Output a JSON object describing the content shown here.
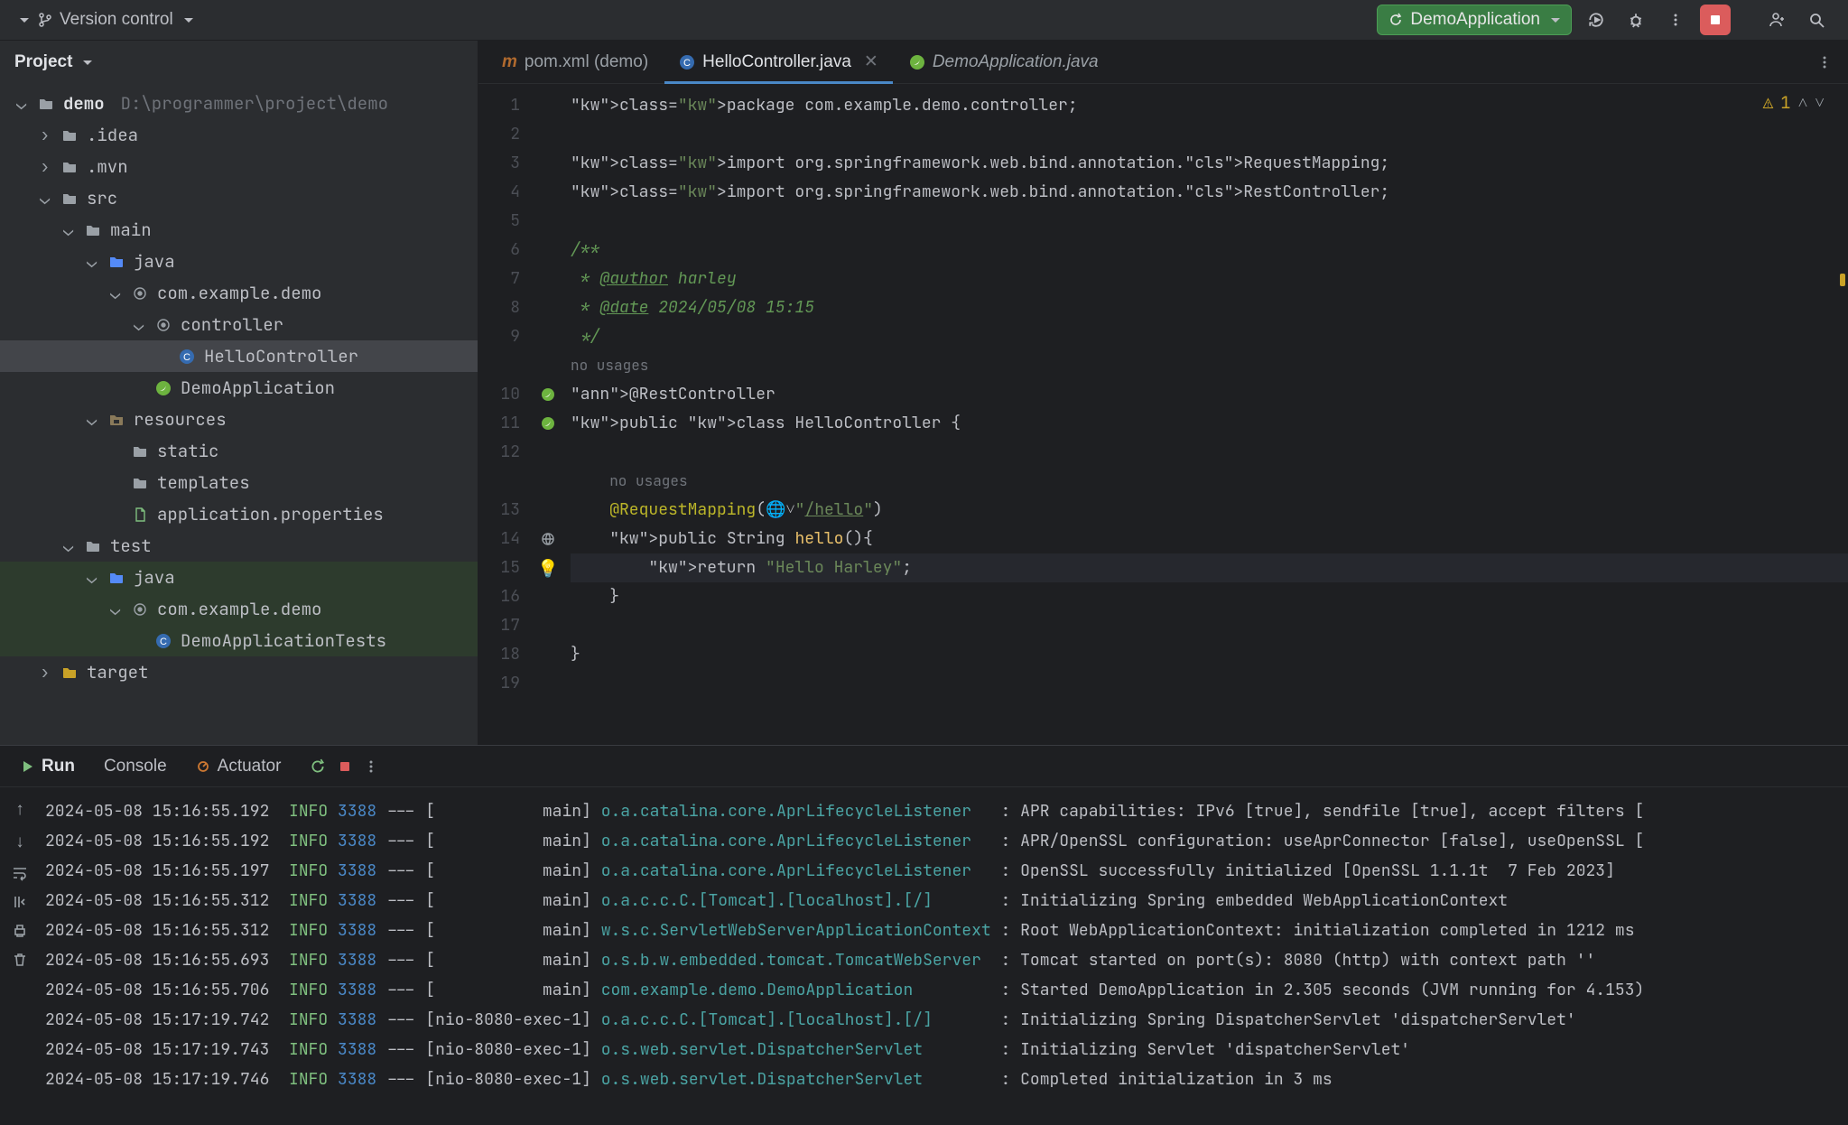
{
  "topbar": {
    "vc_label": "Version control",
    "run_config": "DemoApplication"
  },
  "project": {
    "title": "Project",
    "root": {
      "name": "demo",
      "path": "D:\\programmer\\project\\demo"
    },
    "nodes": [
      {
        "d": 0,
        "arr": "v",
        "ico": "folder-proj",
        "label": "demo",
        "extra": "D:\\programmer\\project\\demo",
        "interact": true
      },
      {
        "d": 1,
        "arr": ">",
        "ico": "folder",
        "label": ".idea",
        "interact": true
      },
      {
        "d": 1,
        "arr": ">",
        "ico": "folder",
        "label": ".mvn",
        "interact": true
      },
      {
        "d": 1,
        "arr": "v",
        "ico": "folder",
        "label": "src",
        "interact": true
      },
      {
        "d": 2,
        "arr": "v",
        "ico": "folder",
        "label": "main",
        "interact": true
      },
      {
        "d": 3,
        "arr": "v",
        "ico": "folder-src",
        "label": "java",
        "interact": true
      },
      {
        "d": 4,
        "arr": "v",
        "ico": "pkg",
        "label": "com.example.demo",
        "interact": true
      },
      {
        "d": 5,
        "arr": "v",
        "ico": "pkg",
        "label": "controller",
        "interact": true
      },
      {
        "d": 6,
        "arr": "",
        "ico": "class",
        "label": "HelloController",
        "interact": true,
        "sel": true
      },
      {
        "d": 5,
        "arr": "",
        "ico": "spring",
        "label": "DemoApplication",
        "interact": true
      },
      {
        "d": 3,
        "arr": "v",
        "ico": "folder-res",
        "label": "resources",
        "interact": true
      },
      {
        "d": 4,
        "arr": "",
        "ico": "folder",
        "label": "static",
        "interact": true
      },
      {
        "d": 4,
        "arr": "",
        "ico": "folder",
        "label": "templates",
        "interact": true
      },
      {
        "d": 4,
        "arr": "",
        "ico": "file-g",
        "label": "application.properties",
        "interact": true
      },
      {
        "d": 2,
        "arr": "v",
        "ico": "folder",
        "label": "test",
        "interact": true
      },
      {
        "d": 3,
        "arr": "v",
        "ico": "folder-src",
        "label": "java",
        "green": true,
        "interact": true
      },
      {
        "d": 4,
        "arr": "v",
        "ico": "pkg",
        "label": "com.example.demo",
        "green": true,
        "interact": true
      },
      {
        "d": 5,
        "arr": "",
        "ico": "class",
        "label": "DemoApplicationTests",
        "green": true,
        "interact": true
      },
      {
        "d": 1,
        "arr": ">",
        "ico": "folder-yel",
        "label": "target",
        "interact": true
      }
    ]
  },
  "tabs": [
    {
      "icon": "m",
      "label": "pom.xml (demo)",
      "active": false,
      "close": false,
      "italic": false
    },
    {
      "icon": "c",
      "label": "HelloController.java",
      "active": true,
      "close": true,
      "italic": false
    },
    {
      "icon": "sp",
      "label": "DemoApplication.java",
      "active": false,
      "close": false,
      "italic": true
    }
  ],
  "editor_status": {
    "warn_count": "1"
  },
  "code": {
    "inlay_nousages": "no usages",
    "lines": [
      "package com.example.demo.controller;",
      "",
      "import org.springframework.web.bind.annotation.RequestMapping;",
      "import org.springframework.web.bind.annotation.RestController;",
      "",
      "/**",
      " * @author harley",
      " * @date 2024/05/08 15:15",
      " */",
      "@RestController",
      "public class HelloController {",
      "",
      "    @RequestMapping(\"/hello\")",
      "    public String hello(){",
      "        return \"Hello Harley\";",
      "    }",
      "",
      "}",
      ""
    ]
  },
  "run_panel": {
    "run_label": "Run",
    "console_label": "Console",
    "actuator_label": "Actuator"
  },
  "log_cols": {
    "level": "INFO",
    "pid": "3388",
    "dash": "---"
  },
  "log": [
    {
      "ts": "2024-05-08 15:16:55.192",
      "thr": "[           main]",
      "src": "o.a.catalina.core.AprLifecycleListener  ",
      "msg": ": APR capabilities: IPv6 [true], sendfile [true], accept filters ["
    },
    {
      "ts": "2024-05-08 15:16:55.192",
      "thr": "[           main]",
      "src": "o.a.catalina.core.AprLifecycleListener  ",
      "msg": ": APR/OpenSSL configuration: useAprConnector [false], useOpenSSL ["
    },
    {
      "ts": "2024-05-08 15:16:55.197",
      "thr": "[           main]",
      "src": "o.a.catalina.core.AprLifecycleListener  ",
      "msg": ": OpenSSL successfully initialized [OpenSSL 1.1.1t  7 Feb 2023]"
    },
    {
      "ts": "2024-05-08 15:16:55.312",
      "thr": "[           main]",
      "src": "o.a.c.c.C.[Tomcat].[localhost].[/]      ",
      "msg": ": Initializing Spring embedded WebApplicationContext"
    },
    {
      "ts": "2024-05-08 15:16:55.312",
      "thr": "[           main]",
      "src": "w.s.c.ServletWebServerApplicationContext",
      "msg": ": Root WebApplicationContext: initialization completed in 1212 ms"
    },
    {
      "ts": "2024-05-08 15:16:55.693",
      "thr": "[           main]",
      "src": "o.s.b.w.embedded.tomcat.TomcatWebServer ",
      "msg": ": Tomcat started on port(s): 8080 (http) with context path ''"
    },
    {
      "ts": "2024-05-08 15:16:55.706",
      "thr": "[           main]",
      "src": "com.example.demo.DemoApplication        ",
      "msg": ": Started DemoApplication in 2.305 seconds (JVM running for 4.153)"
    },
    {
      "ts": "2024-05-08 15:17:19.742",
      "thr": "[nio-8080-exec-1]",
      "src": "o.a.c.c.C.[Tomcat].[localhost].[/]      ",
      "msg": ": Initializing Spring DispatcherServlet 'dispatcherServlet'"
    },
    {
      "ts": "2024-05-08 15:17:19.743",
      "thr": "[nio-8080-exec-1]",
      "src": "o.s.web.servlet.DispatcherServlet       ",
      "msg": ": Initializing Servlet 'dispatcherServlet'"
    },
    {
      "ts": "2024-05-08 15:17:19.746",
      "thr": "[nio-8080-exec-1]",
      "src": "o.s.web.servlet.DispatcherServlet       ",
      "msg": ": Completed initialization in 3 ms"
    }
  ]
}
